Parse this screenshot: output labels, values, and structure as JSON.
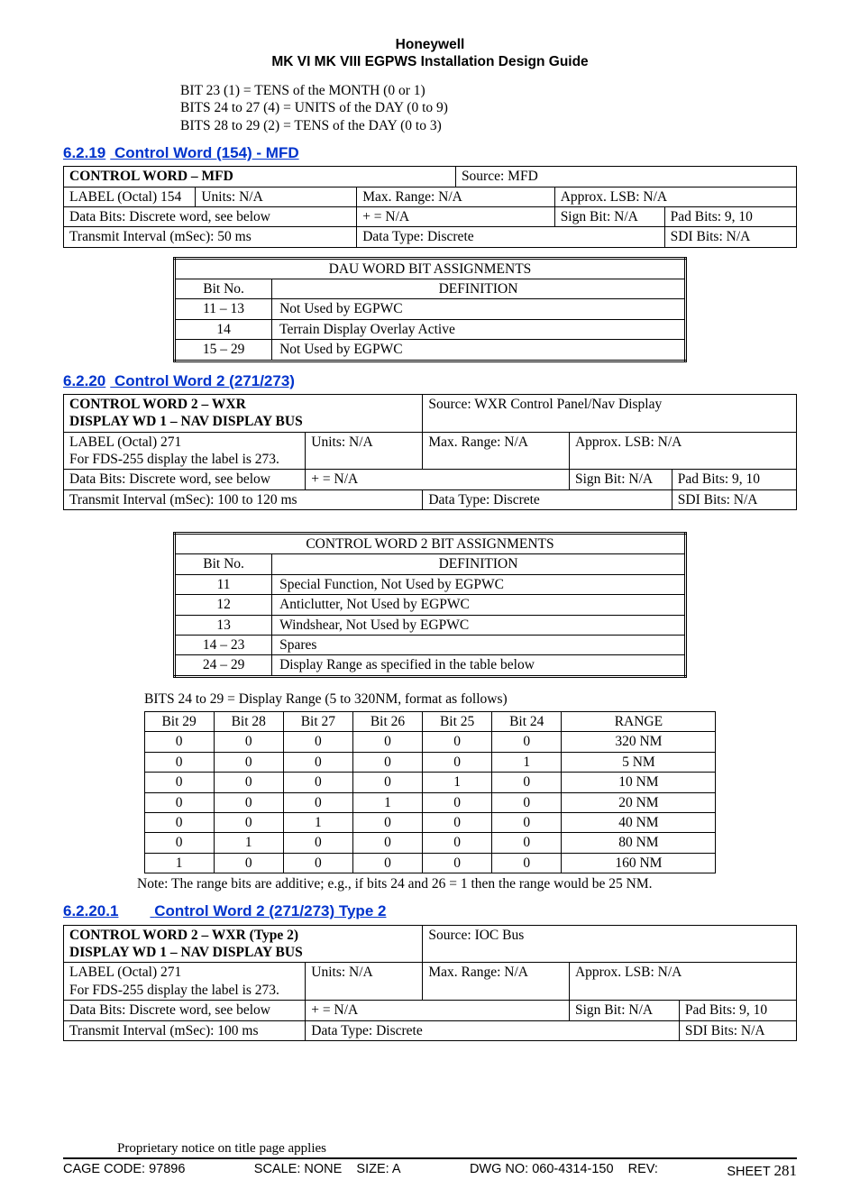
{
  "header": {
    "line1": "Honeywell",
    "line2": "MK VI  MK VIII EGPWS Installation Design Guide"
  },
  "intro_bits": {
    "l1": "BIT 23 (1) = TENS of the MONTH (0 or 1)",
    "l2": "BITS 24 to 27 (4) = UNITS of the DAY (0 to 9)",
    "l3": "BITS 28 to 29 (2) = TENS of the DAY (0 to 3)"
  },
  "s6219": {
    "num": "6.2.19",
    "title": "Control Word (154) - MFD",
    "spec": {
      "name": "CONTROL WORD – MFD",
      "source": "Source:  MFD",
      "label": "LABEL (Octal)  154",
      "units": "Units:  N/A",
      "maxrange": "Max. Range:  N/A",
      "lsb": "Approx. LSB:  N/A",
      "databits": "Data Bits: Discrete word,  see below",
      "plus": "+ =  N/A",
      "signbit": "Sign Bit:  N/A",
      "padbits": "Pad Bits:  9, 10",
      "tx": "Transmit Interval (mSec):  50 ms",
      "datatype": "Data Type: Discrete",
      "sdi": "SDI Bits:  N/A"
    },
    "bits_title": "DAU WORD BIT ASSIGNMENTS",
    "bits_h1": "Bit No.",
    "bits_h2": "DEFINITION",
    "bits_rows": [
      {
        "n": "11 – 13",
        "d": "Not Used by EGPWC"
      },
      {
        "n": "14",
        "d": "Terrain Display Overlay Active"
      },
      {
        "n": "15 – 29",
        "d": "Not Used by EGPWC"
      }
    ]
  },
  "s6220": {
    "num": "6.2.20",
    "title": "Control Word 2 (271/273)",
    "spec": {
      "name1": "CONTROL WORD 2 – WXR",
      "name2": "DISPLAY WD 1 – NAV DISPLAY BUS",
      "source": "Source:  WXR Control Panel/Nav Display",
      "label1": "LABEL (Octal)  271",
      "label2": "For FDS-255 display the label is 273.",
      "units": "Units:  N/A",
      "maxrange": "Max. Range:  N/A",
      "lsb": "Approx. LSB:  N/A",
      "databits": "Data Bits: Discrete word,  see below",
      "plus": "+ =  N/A",
      "signbit": "Sign Bit:  N/A",
      "padbits": "Pad Bits:  9, 10",
      "tx": "Transmit Interval (mSec):  100 to 120 ms",
      "datatype": "Data Type: Discrete",
      "sdi": "SDI Bits:  N/A"
    },
    "bits_title": "CONTROL WORD 2 BIT ASSIGNMENTS",
    "bits_h1": "Bit No.",
    "bits_h2": "DEFINITION",
    "bits_rows": [
      {
        "n": "11",
        "d": "Special Function, Not Used by EGPWC"
      },
      {
        "n": "12",
        "d": "Anticlutter, Not Used by EGPWC"
      },
      {
        "n": "13",
        "d": "Windshear, Not Used by EGPWC"
      },
      {
        "n": "14 – 23",
        "d": "Spares"
      },
      {
        "n": "24 – 29",
        "d": "Display Range as specified in the table below"
      }
    ],
    "range_caption": "BITS 24 to 29 = Display Range (5 to 320NM, format as follows)",
    "range_head": [
      "Bit 29",
      "Bit 28",
      "Bit 27",
      "Bit 26",
      "Bit 25",
      "Bit 24",
      "RANGE"
    ],
    "range_rows": [
      [
        "0",
        "0",
        "0",
        "0",
        "0",
        "0",
        "320 NM"
      ],
      [
        "0",
        "0",
        "0",
        "0",
        "0",
        "1",
        "5 NM"
      ],
      [
        "0",
        "0",
        "0",
        "0",
        "1",
        "0",
        "10 NM"
      ],
      [
        "0",
        "0",
        "0",
        "1",
        "0",
        "0",
        "20 NM"
      ],
      [
        "0",
        "0",
        "1",
        "0",
        "0",
        "0",
        "40 NM"
      ],
      [
        "0",
        "1",
        "0",
        "0",
        "0",
        "0",
        "80 NM"
      ],
      [
        "1",
        "0",
        "0",
        "0",
        "0",
        "0",
        "160 NM"
      ]
    ],
    "range_note": "Note: The range bits are additive; e.g., if bits 24 and 26 = 1 then the range would be 25 NM."
  },
  "s62201": {
    "num": "6.2.20.1",
    "title": "Control Word 2 (271/273) Type 2",
    "spec": {
      "name1": "CONTROL WORD 2 – WXR (Type 2)",
      "name2": "DISPLAY WD 1 – NAV DISPLAY BUS",
      "source": "Source:  IOC Bus",
      "label1": "LABEL (Octal)  271",
      "label2": "For FDS-255 display the label is 273.",
      "units": "Units:  N/A",
      "maxrange": "Max. Range:  N/A",
      "lsb": "Approx. LSB:  N/A",
      "databits": "Data Bits: Discrete word,  see below",
      "plus": "+ =  N/A",
      "signbit": "Sign Bit:  N/A",
      "padbits": "Pad Bits:  9, 10",
      "tx": "Transmit Interval (mSec):  100 ms",
      "datatype": "Data Type: Discrete",
      "sdi": "SDI Bits:  N/A"
    }
  },
  "footer": {
    "prop": "Proprietary notice on title page applies",
    "cage": "CAGE CODE: 97896",
    "scale": "SCALE: NONE",
    "size": "SIZE: A",
    "dwg": "DWG NO: 060-4314-150",
    "rev": "REV:",
    "sheet_l": "SHEET",
    "sheet_n": "281"
  }
}
